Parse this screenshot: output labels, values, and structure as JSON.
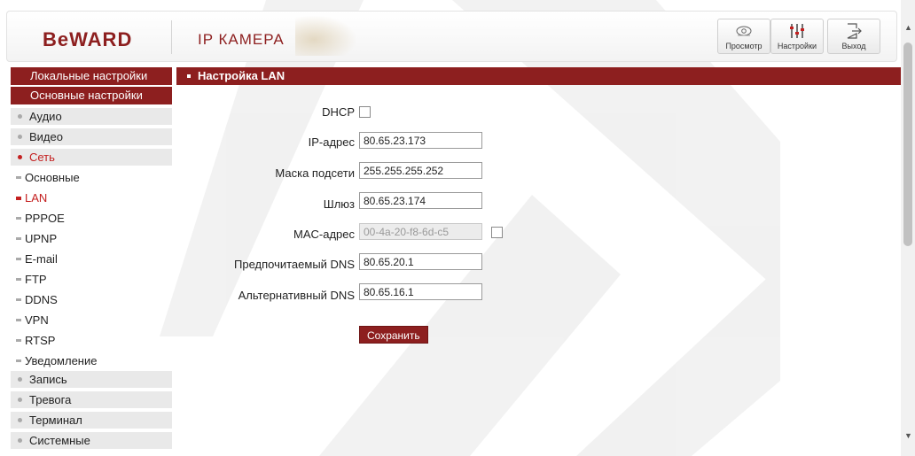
{
  "header": {
    "logo": "BeWARD",
    "title": "IP КАМЕРА",
    "buttons": {
      "view_label": "Просмотр",
      "settings_label": "Настройки",
      "exit_label": "Выход"
    }
  },
  "sidebar": {
    "local_settings": "Локальные настройки",
    "main_settings": "Основные настройки",
    "items": [
      {
        "label": "Аудио"
      },
      {
        "label": "Видео"
      },
      {
        "label": "Сеть"
      }
    ],
    "sub_items": [
      {
        "label": "Основные"
      },
      {
        "label": "LAN"
      },
      {
        "label": "PPPOE"
      },
      {
        "label": "UPNP"
      },
      {
        "label": "E-mail"
      },
      {
        "label": "FTP"
      },
      {
        "label": "DDNS"
      },
      {
        "label": "VPN"
      },
      {
        "label": "RTSP"
      },
      {
        "label": "Уведомление"
      }
    ],
    "bottom_items": [
      {
        "label": "Запись"
      },
      {
        "label": "Тревога"
      },
      {
        "label": "Терминал"
      },
      {
        "label": "Системные"
      }
    ]
  },
  "main": {
    "section_title": "Настройка LAN",
    "dhcp_label": "DHCP",
    "ip_label": "IP-адрес",
    "ip_value": "80.65.23.173",
    "mask_label": "Маска подсети",
    "mask_value": "255.255.255.252",
    "gateway_label": "Шлюз",
    "gateway_value": "80.65.23.174",
    "mac_label": "MAC-адрес",
    "mac_value": "00-4a-20-f8-6d-c5",
    "dns1_label": "Предпочитаемый DNS",
    "dns1_value": "80.65.20.1",
    "dns2_label": "Альтернативный DNS",
    "dns2_value": "80.65.16.1",
    "save_label": "Сохранить"
  },
  "colors": {
    "brand": "#8d1f1f",
    "active": "#c42020"
  }
}
